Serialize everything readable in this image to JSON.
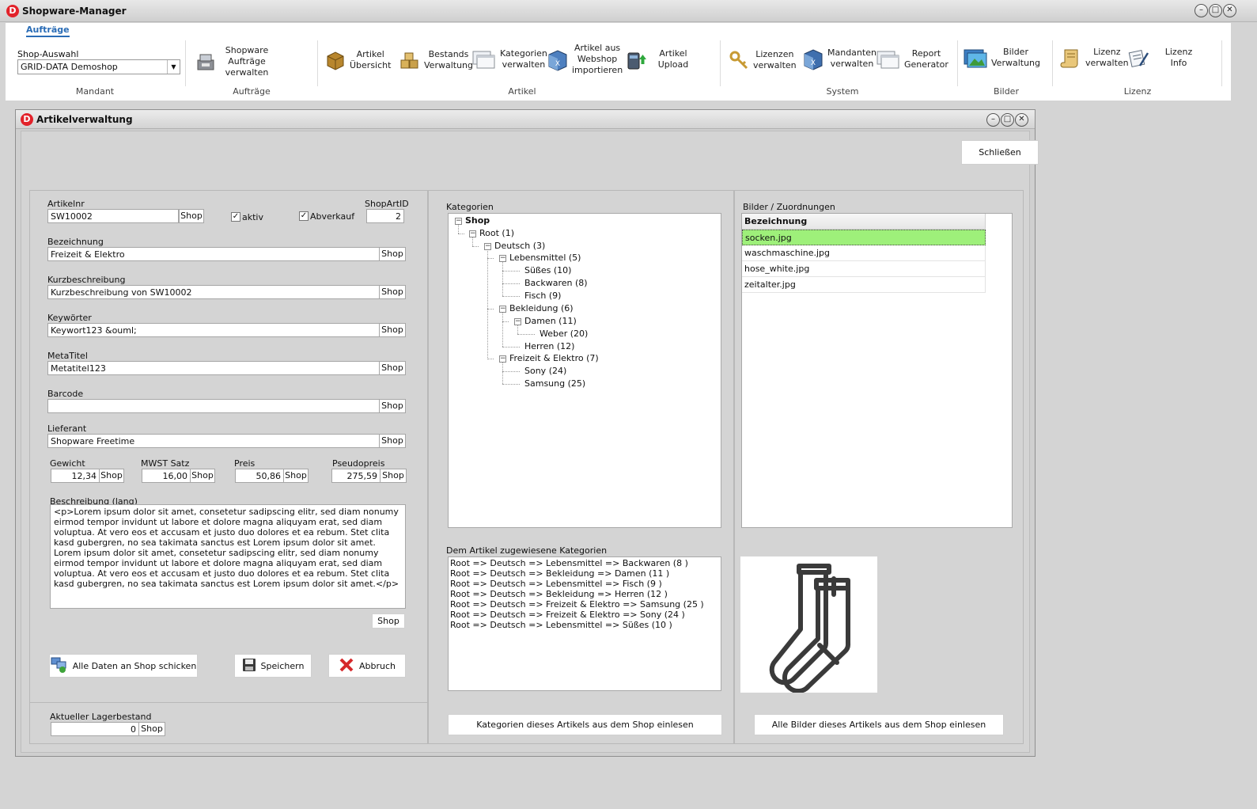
{
  "app": {
    "title": "Shopware-Manager",
    "logo": "D"
  },
  "ribbon": {
    "active_tab": "Aufträge",
    "shop_select": {
      "label": "Shop-Auswahl",
      "value": "GRID-DATA Demoshop"
    },
    "groups": {
      "mandant": "Mandant",
      "auftraege": "Aufträge",
      "artikel": "Artikel",
      "system": "System",
      "bilder": "Bilder",
      "lizenz": "Lizenz"
    },
    "buttons": {
      "auftraege": "Shopware\nAufträge\nverwalten",
      "artikel_uebersicht": "Artikel\nÜbersicht",
      "bestand": "Bestands\nVerwaltung",
      "kategorien": "Kategorien\nverwalten",
      "import": "Artikel aus\nWebshop\nimportieren",
      "upload": "Artikel\nUpload",
      "lizenzen": "Lizenzen\nverwalten",
      "mandanten": "Mandanten\nverwalten",
      "report": "Report\nGenerator",
      "bilder": "Bilder\nVerwaltung",
      "lizenz_verwalten": "Lizenz\nverwalten",
      "lizenz_info": "Lizenz\nInfo"
    }
  },
  "subwindow": {
    "title": "Artikelverwaltung",
    "close_label": "Schließen"
  },
  "form": {
    "shop_label": "Shop",
    "artikelnr": {
      "label": "Artikelnr",
      "value": "SW10002"
    },
    "aktiv": {
      "label": "aktiv",
      "checked": true
    },
    "abverkauf": {
      "label": "Abverkauf",
      "checked": true
    },
    "shopartid": {
      "label": "ShopArtID",
      "value": "2"
    },
    "bezeichnung": {
      "label": "Bezeichnung",
      "value": "Freizeit & Elektro"
    },
    "kurzbeschreibung": {
      "label": "Kurzbeschreibung",
      "value": "Kurzbeschreibung von SW10002"
    },
    "keywoerter": {
      "label": "Keywörter",
      "value": "Keywort123 &ouml;"
    },
    "metatitel": {
      "label": "MetaTitel",
      "value": "Metatitel123"
    },
    "barcode": {
      "label": "Barcode",
      "value": ""
    },
    "lieferant": {
      "label": "Lieferant",
      "value": "Shopware Freetime"
    },
    "gewicht": {
      "label": "Gewicht",
      "value": "12,34"
    },
    "mwst": {
      "label": "MWST Satz",
      "value": "16,00"
    },
    "preis": {
      "label": "Preis",
      "value": "50,86"
    },
    "pseudopreis": {
      "label": "Pseudopreis",
      "value": "275,59"
    },
    "beschreibung": {
      "label": "Beschreibung (lang)",
      "value": "<p>Lorem ipsum dolor sit amet, consetetur sadipscing elitr, sed diam nonumy eirmod tempor invidunt ut labore et dolore magna aliquyam erat, sed diam voluptua. At vero eos et accusam et justo duo dolores et ea rebum. Stet clita kasd gubergren, no sea takimata sanctus est Lorem ipsum dolor sit amet. Lorem ipsum dolor sit amet, consetetur sadipscing elitr, sed diam nonumy eirmod tempor invidunt ut labore et dolore magna aliquyam erat, sed diam voluptua. At vero eos et accusam et justo duo dolores et ea rebum. Stet clita kasd gubergren, no sea takimata sanctus est Lorem ipsum dolor sit amet.</p>"
    },
    "send_all": "Alle Daten an Shop schicken",
    "save": "Speichern",
    "cancel": "Abbruch",
    "lagerbestand": {
      "label": "Aktueller Lagerbestand",
      "value": "0"
    }
  },
  "categories": {
    "label": "Kategorien",
    "tree": {
      "shop": "Shop",
      "root": "Root (1)",
      "deutsch": "Deutsch (3)",
      "lebensmittel": "Lebensmittel (5)",
      "suesses": "Süßes (10)",
      "backwaren": "Backwaren (8)",
      "fisch": "Fisch (9)",
      "bekleidung": "Bekleidung (6)",
      "damen": "Damen (11)",
      "weber": "Weber (20)",
      "herren": "Herren (12)",
      "freizeit": "Freizeit & Elektro (7)",
      "sony": "Sony (24)",
      "samsung": "Samsung (25)"
    },
    "assigned_label": "Dem Artikel zugewiesene Kategorien",
    "assigned": [
      "Root => Deutsch => Lebensmittel => Backwaren (8 )",
      "Root => Deutsch => Bekleidung => Damen (11 )",
      "Root => Deutsch => Lebensmittel => Fisch (9 )",
      "Root => Deutsch => Bekleidung => Herren (12 )",
      "Root => Deutsch => Freizeit & Elektro => Samsung (25 )",
      "Root => Deutsch => Freizeit & Elektro => Sony (24 )",
      "Root => Deutsch => Lebensmittel => Süßes (10 )"
    ],
    "read_button": "Kategorien dieses Artikels aus dem Shop einlesen"
  },
  "images": {
    "label": "Bilder / Zuordnungen",
    "column": "Bezeichnung",
    "rows": [
      "socken.jpg",
      "waschmaschine.jpg",
      "hose_white.jpg",
      "zeitalter.jpg"
    ],
    "selected_index": 0,
    "selected_color": "#9ef07a",
    "read_button": "Alle Bilder dieses Artikels aus dem Shop einlesen",
    "preview_icon": "socks-icon"
  }
}
